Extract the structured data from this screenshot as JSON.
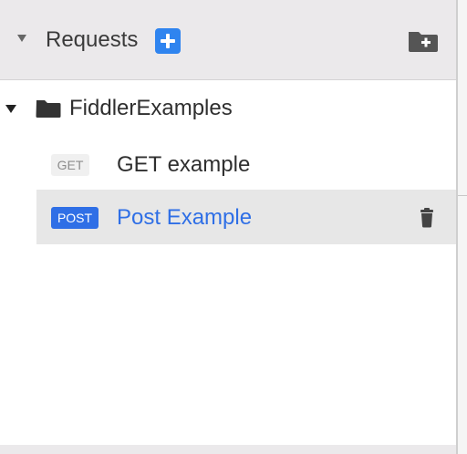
{
  "header": {
    "title": "Requests"
  },
  "tree": {
    "folder": {
      "label": "FiddlerExamples",
      "expanded": true
    },
    "requests": [
      {
        "method": "GET",
        "label": "GET example",
        "selected": false
      },
      {
        "method": "POST",
        "label": "Post Example",
        "selected": true
      }
    ]
  },
  "icons": {
    "collapse": "triangle-down-icon",
    "add": "plus-square-icon",
    "new_folder": "folder-plus-icon",
    "folder": "folder-icon",
    "delete": "trash-icon"
  },
  "colors": {
    "accent": "#2f6fe6",
    "add_button": "#2f84ef",
    "header_bg": "#ebe9eb",
    "selected_row_bg": "#e7e7e7",
    "text": "#2f2f2f"
  }
}
